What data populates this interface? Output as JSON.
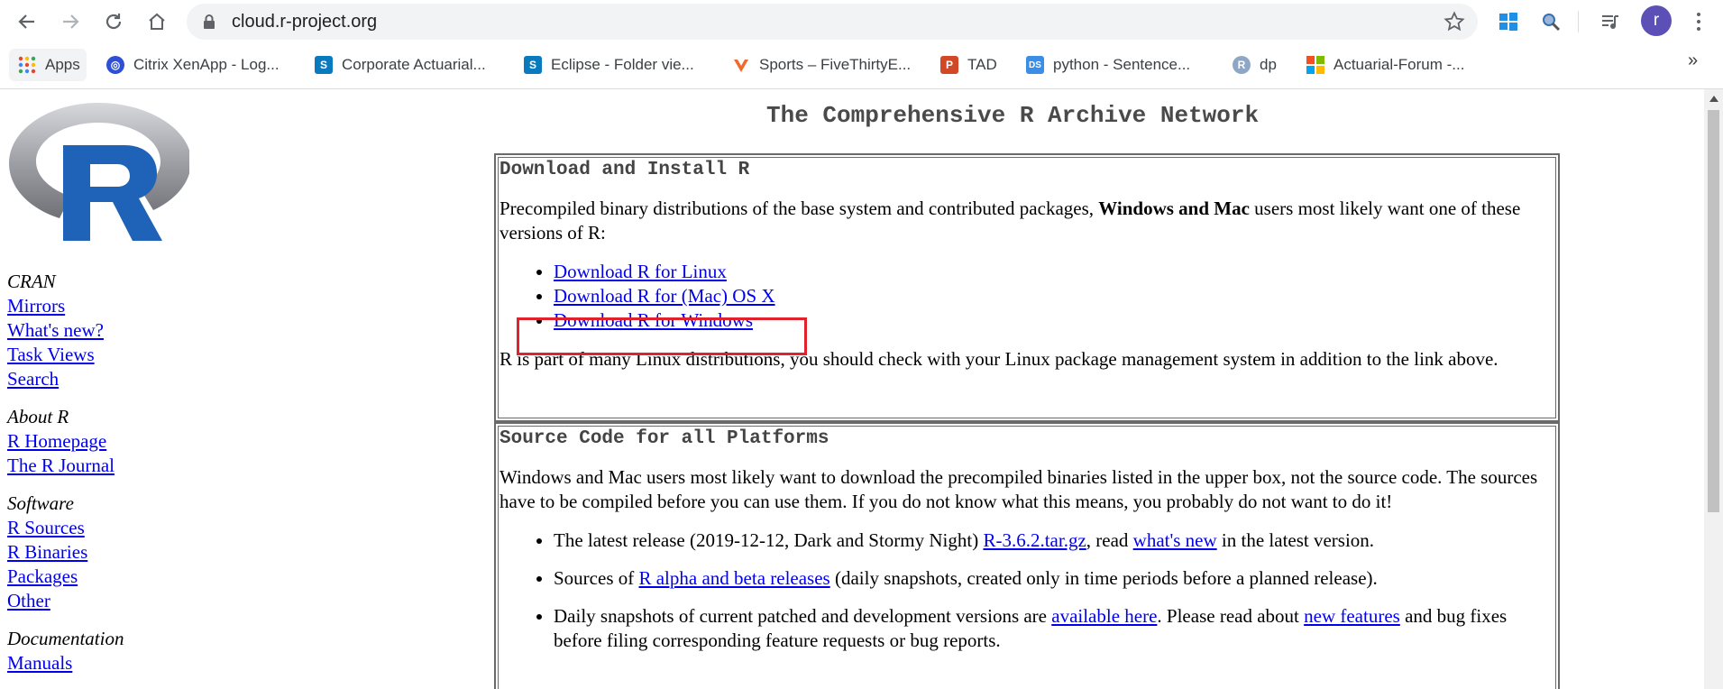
{
  "browser": {
    "url": "cloud.r-project.org",
    "avatar_letter": "r",
    "bookmarks": [
      {
        "label": "Apps",
        "icon": "apps-grid-icon"
      },
      {
        "label": "Citrix XenApp - Log...",
        "icon": "citrix-icon"
      },
      {
        "label": "Corporate Actuarial...",
        "icon": "sharepoint-icon"
      },
      {
        "label": "Eclipse - Folder vie...",
        "icon": "sharepoint-icon"
      },
      {
        "label": "Sports – FiveThirtyE...",
        "icon": "fivethirtyeight-icon"
      },
      {
        "label": "TAD",
        "icon": "powerpoint-icon"
      },
      {
        "label": "python - Sentence...",
        "icon": "datascience-icon"
      },
      {
        "label": "dp",
        "icon": "r-bookmark-icon"
      },
      {
        "label": "Actuarial-Forum -...",
        "icon": "microsoft-icon"
      }
    ],
    "overflow_label": "»"
  },
  "page": {
    "title": "The Comprehensive R Archive Network",
    "sidebar": {
      "cran_heading": "CRAN",
      "cran_links": [
        "Mirrors",
        "What's new?",
        "Task Views",
        "Search"
      ],
      "about_heading": "About R",
      "about_links": [
        "R Homepage",
        "The R Journal"
      ],
      "software_heading": "Software",
      "software_links": [
        "R Sources",
        "R Binaries",
        "Packages",
        "Other"
      ],
      "doc_heading": "Documentation",
      "doc_links": [
        "Manuals"
      ]
    },
    "download_box": {
      "heading": "Download and Install R",
      "intro_pre": "Precompiled binary distributions of the base system and contributed packages, ",
      "intro_bold": "Windows and Mac",
      "intro_post": " users most likely want one of these versions of R:",
      "links": [
        "Download R for Linux",
        "Download R for (Mac) OS X",
        "Download R for Windows"
      ],
      "note": "R is part of many Linux distributions, you should check with your Linux package management system in addition to the link above."
    },
    "source_box": {
      "heading": "Source Code for all Platforms",
      "intro": "Windows and Mac users most likely want to download the precompiled binaries listed in the upper box, not the source code. The sources have to be compiled before you can use them. If you do not know what this means, you probably do not want to do it!",
      "item1_pre": "The latest release (2019-12-12, Dark and Stormy Night) ",
      "item1_link1": "R-3.6.2.tar.gz",
      "item1_mid": ", read ",
      "item1_link2": "what's new",
      "item1_post": " in the latest version.",
      "item2_pre": "Sources of ",
      "item2_link": "R alpha and beta releases",
      "item2_post": " (daily snapshots, created only in time periods before a planned release).",
      "item3_pre": "Daily snapshots of current patched and development versions are ",
      "item3_link1": "available here",
      "item3_mid": ". Please read about ",
      "item3_link2": "new features",
      "item3_tail": "and bug fixes before filing corresponding feature requests or bug reports."
    }
  },
  "colors": {
    "link": "#0000ee",
    "highlight": "#e0222c",
    "r_logo_blue": "#1e63b8",
    "r_logo_grey": "#9a9ca2"
  }
}
